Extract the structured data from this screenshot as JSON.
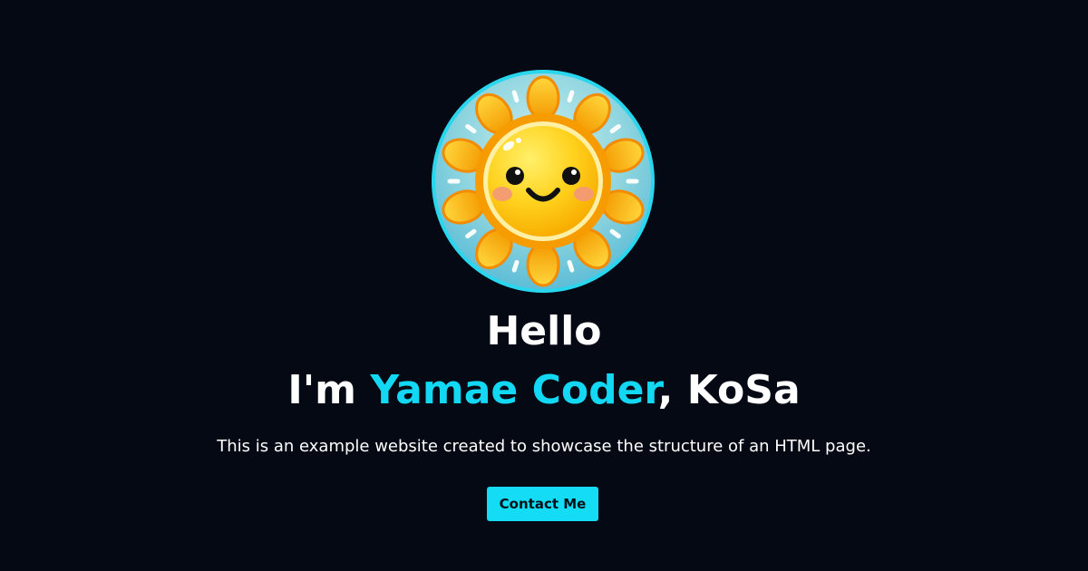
{
  "hero": {
    "avatar_icon": "smiling-sun-icon",
    "greeting": "Hello",
    "intro_prefix": "I'm ",
    "name": "Yamae Coder",
    "intro_suffix": ", KoSa",
    "description": "This is an example website created to showcase the structure of an HTML page.",
    "contact_button_label": "Contact Me"
  },
  "colors": {
    "background": "#050914",
    "accent": "#12d8f3",
    "text": "#ffffff"
  }
}
